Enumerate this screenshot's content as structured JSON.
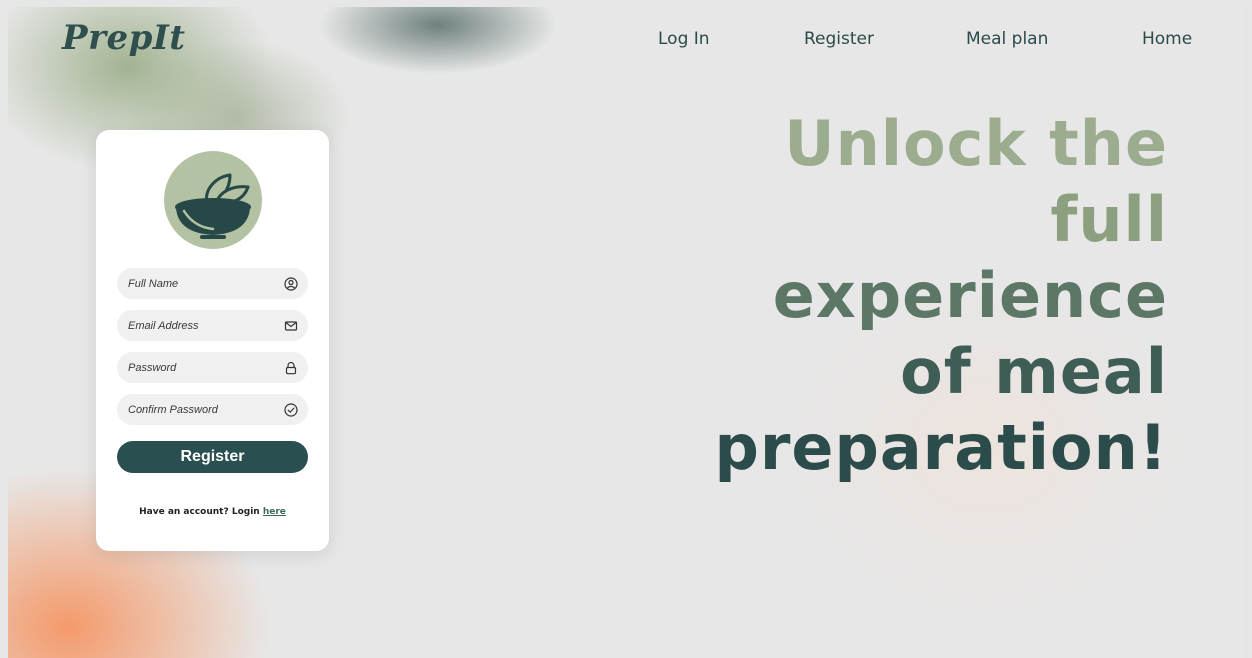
{
  "brand": {
    "logo_text": "PrepIt"
  },
  "nav": {
    "items": [
      {
        "label": "Log In"
      },
      {
        "label": "Register"
      },
      {
        "label": "Meal plan"
      },
      {
        "label": "Home"
      }
    ]
  },
  "form": {
    "fields": [
      {
        "placeholder": "Full Name",
        "icon": "user-circle-icon"
      },
      {
        "placeholder": "Email Address",
        "icon": "mail-icon"
      },
      {
        "placeholder": "Password",
        "icon": "lock-icon"
      },
      {
        "placeholder": "Confirm Password",
        "icon": "check-circle-icon"
      }
    ],
    "submit_label": "Register",
    "login_prompt": "Have an account? Login ",
    "login_link": "here"
  },
  "hero": {
    "lines": [
      "Unlock the",
      "full",
      "experience",
      "of meal",
      "preparation!"
    ]
  },
  "colors": {
    "primary": "#2a4f50",
    "sage": "#b3c2a3",
    "field_bg": "#f0f0f0"
  }
}
